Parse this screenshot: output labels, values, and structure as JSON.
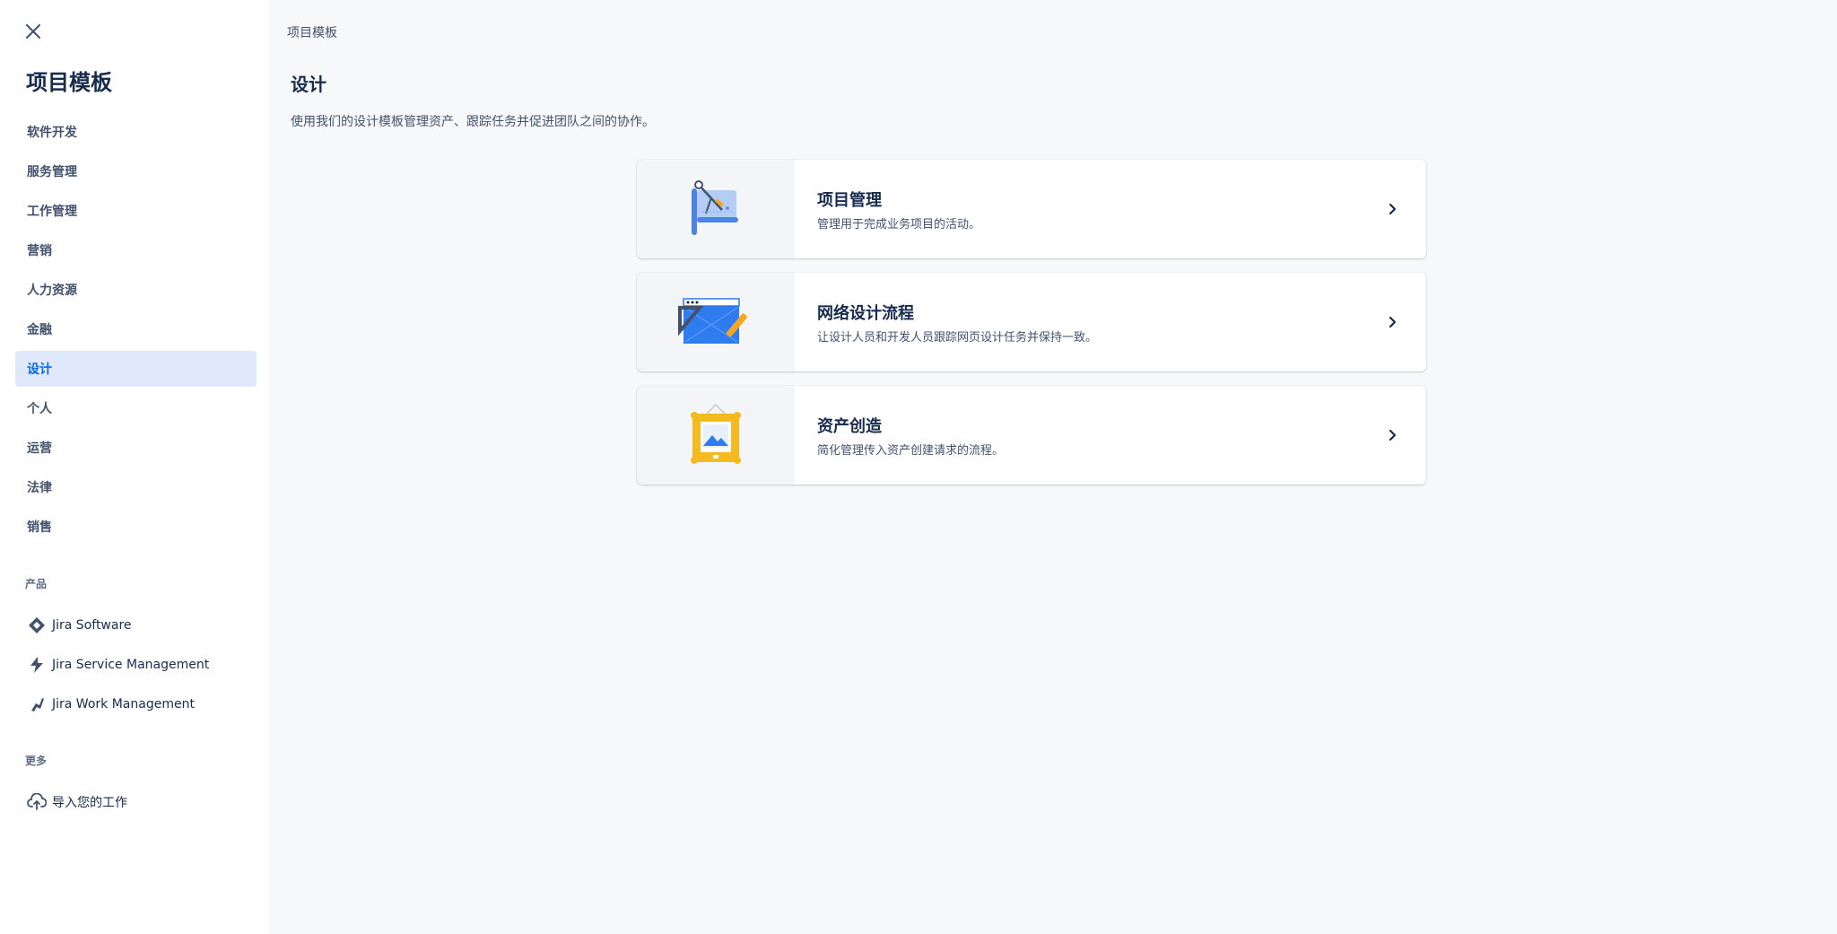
{
  "sidebar": {
    "title": "项目模板",
    "categories": [
      {
        "label": "软件开发",
        "active": false
      },
      {
        "label": "服务管理",
        "active": false
      },
      {
        "label": "工作管理",
        "active": false
      },
      {
        "label": "营销",
        "active": false
      },
      {
        "label": "人力资源",
        "active": false
      },
      {
        "label": "金融",
        "active": false
      },
      {
        "label": "设计",
        "active": true
      },
      {
        "label": "个人",
        "active": false
      },
      {
        "label": "运营",
        "active": false
      },
      {
        "label": "法律",
        "active": false
      },
      {
        "label": "销售",
        "active": false
      }
    ],
    "products_label": "产品",
    "products": [
      {
        "label": "Jira Software",
        "icon": "jira-software-icon"
      },
      {
        "label": "Jira Service Management",
        "icon": "jira-service-management-icon"
      },
      {
        "label": "Jira Work Management",
        "icon": "jira-work-management-icon"
      }
    ],
    "more_label": "更多",
    "more": [
      {
        "label": "导入您的工作",
        "icon": "cloud-upload-icon"
      }
    ]
  },
  "main": {
    "breadcrumb": "项目模板",
    "title": "设计",
    "description": "使用我们的设计模板管理资产、跟踪任务并促进团队之间的协作。",
    "templates": [
      {
        "title": "项目管理",
        "description": "管理用于完成业务项目的活动。",
        "icon": "blueprint-illustration"
      },
      {
        "title": "网络设计流程",
        "description": "让设计人员和开发人员跟踪网页设计任务并保持一致。",
        "icon": "web-design-illustration"
      },
      {
        "title": "资产创造",
        "description": "简化管理传入资产创建请求的流程。",
        "icon": "picture-frame-illustration"
      }
    ]
  },
  "colors": {
    "active_bg": "#dfe9fb",
    "active_text": "#0c66e4",
    "text_primary": "#172b4d",
    "text_secondary": "#42526e"
  }
}
